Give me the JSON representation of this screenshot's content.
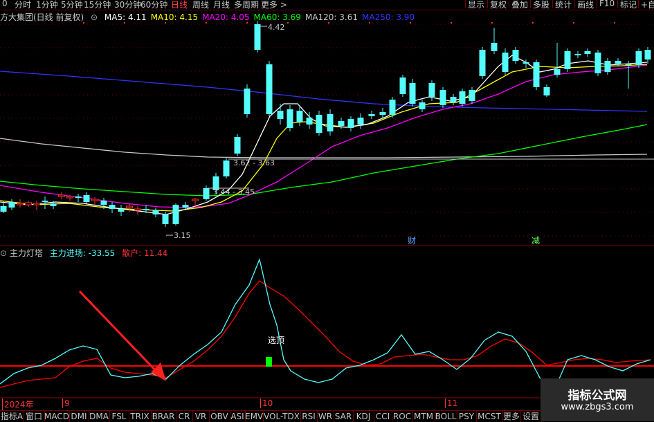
{
  "toolbar": {
    "left_items": [
      {
        "label": "0",
        "active": false
      },
      {
        "label": "分时",
        "active": false
      },
      {
        "label": "1分钟",
        "active": false
      },
      {
        "label": "5分钟",
        "active": false
      },
      {
        "label": "15分钟",
        "active": false
      },
      {
        "label": "30分钟",
        "active": false
      },
      {
        "label": "60分钟",
        "active": false
      },
      {
        "label": "日线",
        "active": true
      },
      {
        "label": "周线",
        "active": false
      },
      {
        "label": "月线",
        "active": false
      },
      {
        "label": "多周期",
        "active": false
      },
      {
        "label": "更多 >",
        "active": false
      }
    ],
    "right_items": [
      "显示",
      "复权",
      "叠加",
      "多股",
      "统计",
      "画线",
      "F10",
      "标记",
      "+自"
    ]
  },
  "main_chart": {
    "title": "方大集团(日线 前复权)",
    "ma": [
      {
        "label": "MA5: 4.11",
        "color": "#ffffff"
      },
      {
        "label": "MA10: 4.15",
        "color": "#ffff00"
      },
      {
        "label": "MA20: 4.05",
        "color": "#ff00ff"
      },
      {
        "label": "MA60: 3.69",
        "color": "#00ff00"
      },
      {
        "label": "MA120: 3.61",
        "color": "#c8c8c8"
      },
      {
        "label": "MA250: 3.90",
        "color": "#3333ff"
      }
    ],
    "annotations": {
      "high": "4.42",
      "low": "3.15",
      "gap1": "3.62 - 3.63",
      "gap2": "3.44 - 3.45",
      "marker1": "财",
      "marker2": "减"
    }
  },
  "indicator": {
    "title": "主力灯塔",
    "main_label": "主力进场: -33.55",
    "retail_label": "散户: 11.44",
    "signal_text": "选顶"
  },
  "time_axis": [
    "2024年",
    "9",
    "10",
    "11"
  ],
  "bottom_tabs": [
    {
      "label": "指标A",
      "active": false
    },
    {
      "label": "窗口",
      "active": false
    },
    {
      "label": "MACD",
      "active": false
    },
    {
      "label": "DMI",
      "active": false
    },
    {
      "label": "DMA",
      "active": false
    },
    {
      "label": "FSL",
      "active": false
    },
    {
      "label": "TRIX",
      "active": false
    },
    {
      "label": "BRAR",
      "active": false
    },
    {
      "label": "CR",
      "active": false
    },
    {
      "label": "VR",
      "active": false
    },
    {
      "label": "OBV",
      "active": false
    },
    {
      "label": "ASI",
      "active": false
    },
    {
      "label": "EMV",
      "active": false
    },
    {
      "label": "VOL-TDX",
      "active": false
    },
    {
      "label": "RSI",
      "active": false
    },
    {
      "label": "WR",
      "active": false
    },
    {
      "label": "SAR",
      "active": false
    },
    {
      "label": "KDJ",
      "active": false
    },
    {
      "label": "CCI",
      "active": false
    },
    {
      "label": "ROC",
      "active": false
    },
    {
      "label": "MTM",
      "active": false
    },
    {
      "label": "BOLL",
      "active": false
    },
    {
      "label": "PSY",
      "active": false
    },
    {
      "label": "MCST",
      "active": false
    },
    {
      "label": "更多",
      "active": false
    },
    {
      "label": "设置",
      "active": false
    }
  ],
  "watermark": {
    "title": "指标公式网",
    "url": "www.zbgs3.com"
  },
  "colors": {
    "up": "#ff3232",
    "down": "#54fcfc",
    "ma5": "#ffffff",
    "ma10": "#ffff00",
    "ma20": "#ff00ff",
    "ma60": "#00ff00",
    "ma120": "#c8c8c8",
    "ma250": "#3333ff",
    "main": "#54fcfc",
    "retail": "#ff0000"
  }
}
